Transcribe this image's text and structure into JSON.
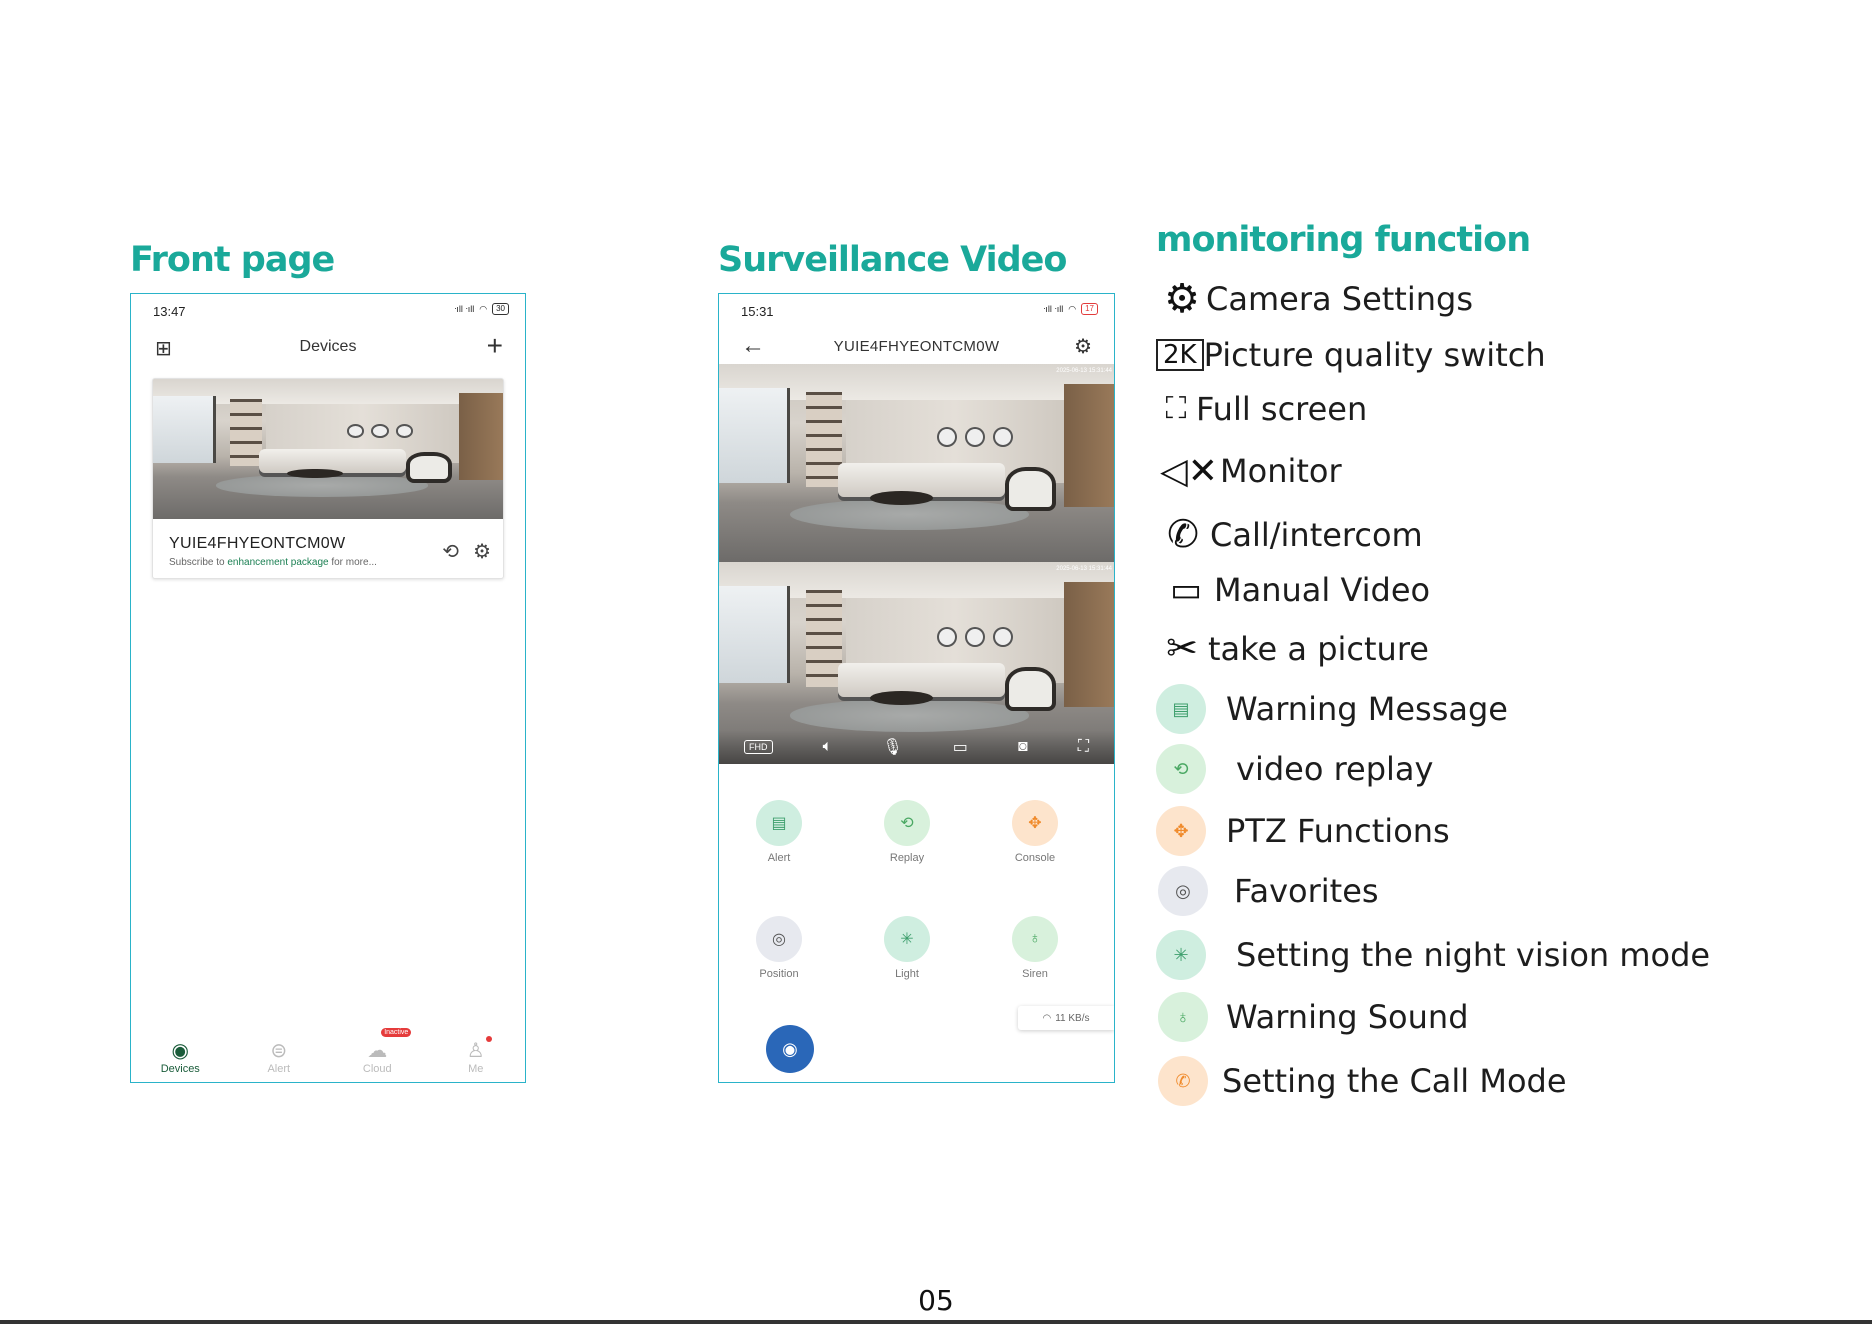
{
  "front_page": {
    "title": "Front page",
    "status_time": "13:47",
    "battery": "30",
    "toolbar_title": "Devices",
    "device": {
      "name": "YUIE4FHYEONTCM0W",
      "sub_prefix": "Subscribe to ",
      "sub_highlight": "enhancement package",
      "sub_suffix": " for more..."
    },
    "tabs": [
      {
        "label": "Devices"
      },
      {
        "label": "Alert"
      },
      {
        "label": "Cloud",
        "badge": "Inactive"
      },
      {
        "label": "Me"
      }
    ]
  },
  "surveillance": {
    "title": "Surveillance Video",
    "status_time": "15:31",
    "battery": "17",
    "device_title": "YUIE4FHYEONTCM0W",
    "timestamp": "2025-06-13 15:31:44",
    "quality_label": "FHD",
    "functions": [
      {
        "label": "Alert",
        "color": "#cfeee0",
        "fg": "#3e9f6d",
        "icon": "message-icon"
      },
      {
        "label": "Replay",
        "color": "#d8f1dc",
        "fg": "#4aa863",
        "icon": "replay-icon"
      },
      {
        "label": "Console",
        "color": "#fde4cc",
        "fg": "#f08b2c",
        "icon": "ptz-icon"
      },
      {
        "label": "Position",
        "color": "#e7e9ef",
        "fg": "#555",
        "icon": "position-icon"
      },
      {
        "label": "Light",
        "color": "#cfeee0",
        "fg": "#3e9f6d",
        "icon": "light-icon"
      },
      {
        "label": "Siren",
        "color": "#d8f1dc",
        "fg": "#4aa863",
        "icon": "siren-icon"
      }
    ],
    "speed": "11 KB/s"
  },
  "legend": {
    "title": "monitoring function",
    "items": [
      {
        "label": "Camera Settings",
        "icon": "gear-icon"
      },
      {
        "label": "Picture quality switch",
        "icon": "2k-icon",
        "icon_text": "2K"
      },
      {
        "label": "Full screen",
        "icon": "fullscreen-icon"
      },
      {
        "label": "Monitor",
        "icon": "mute-icon"
      },
      {
        "label": "Call/intercom",
        "icon": "phone-icon"
      },
      {
        "label": "Manual Video",
        "icon": "video-icon"
      },
      {
        "label": "take a picture",
        "icon": "scissors-icon"
      },
      {
        "label": "Warning Message",
        "icon": "message-icon"
      },
      {
        "label": "video replay",
        "icon": "replay-icon"
      },
      {
        "label": "PTZ Functions",
        "icon": "ptz-icon"
      },
      {
        "label": "Favorites",
        "icon": "position-icon"
      },
      {
        "label": "Setting the night vision mode",
        "icon": "light-icon"
      },
      {
        "label": "Warning Sound",
        "icon": "siren-icon"
      },
      {
        "label": "Setting the Call Mode",
        "icon": "call-mode-icon"
      }
    ]
  },
  "page_number": "05",
  "colors": {
    "accent": "#1aa99a",
    "frame": "#2ab3c9"
  }
}
